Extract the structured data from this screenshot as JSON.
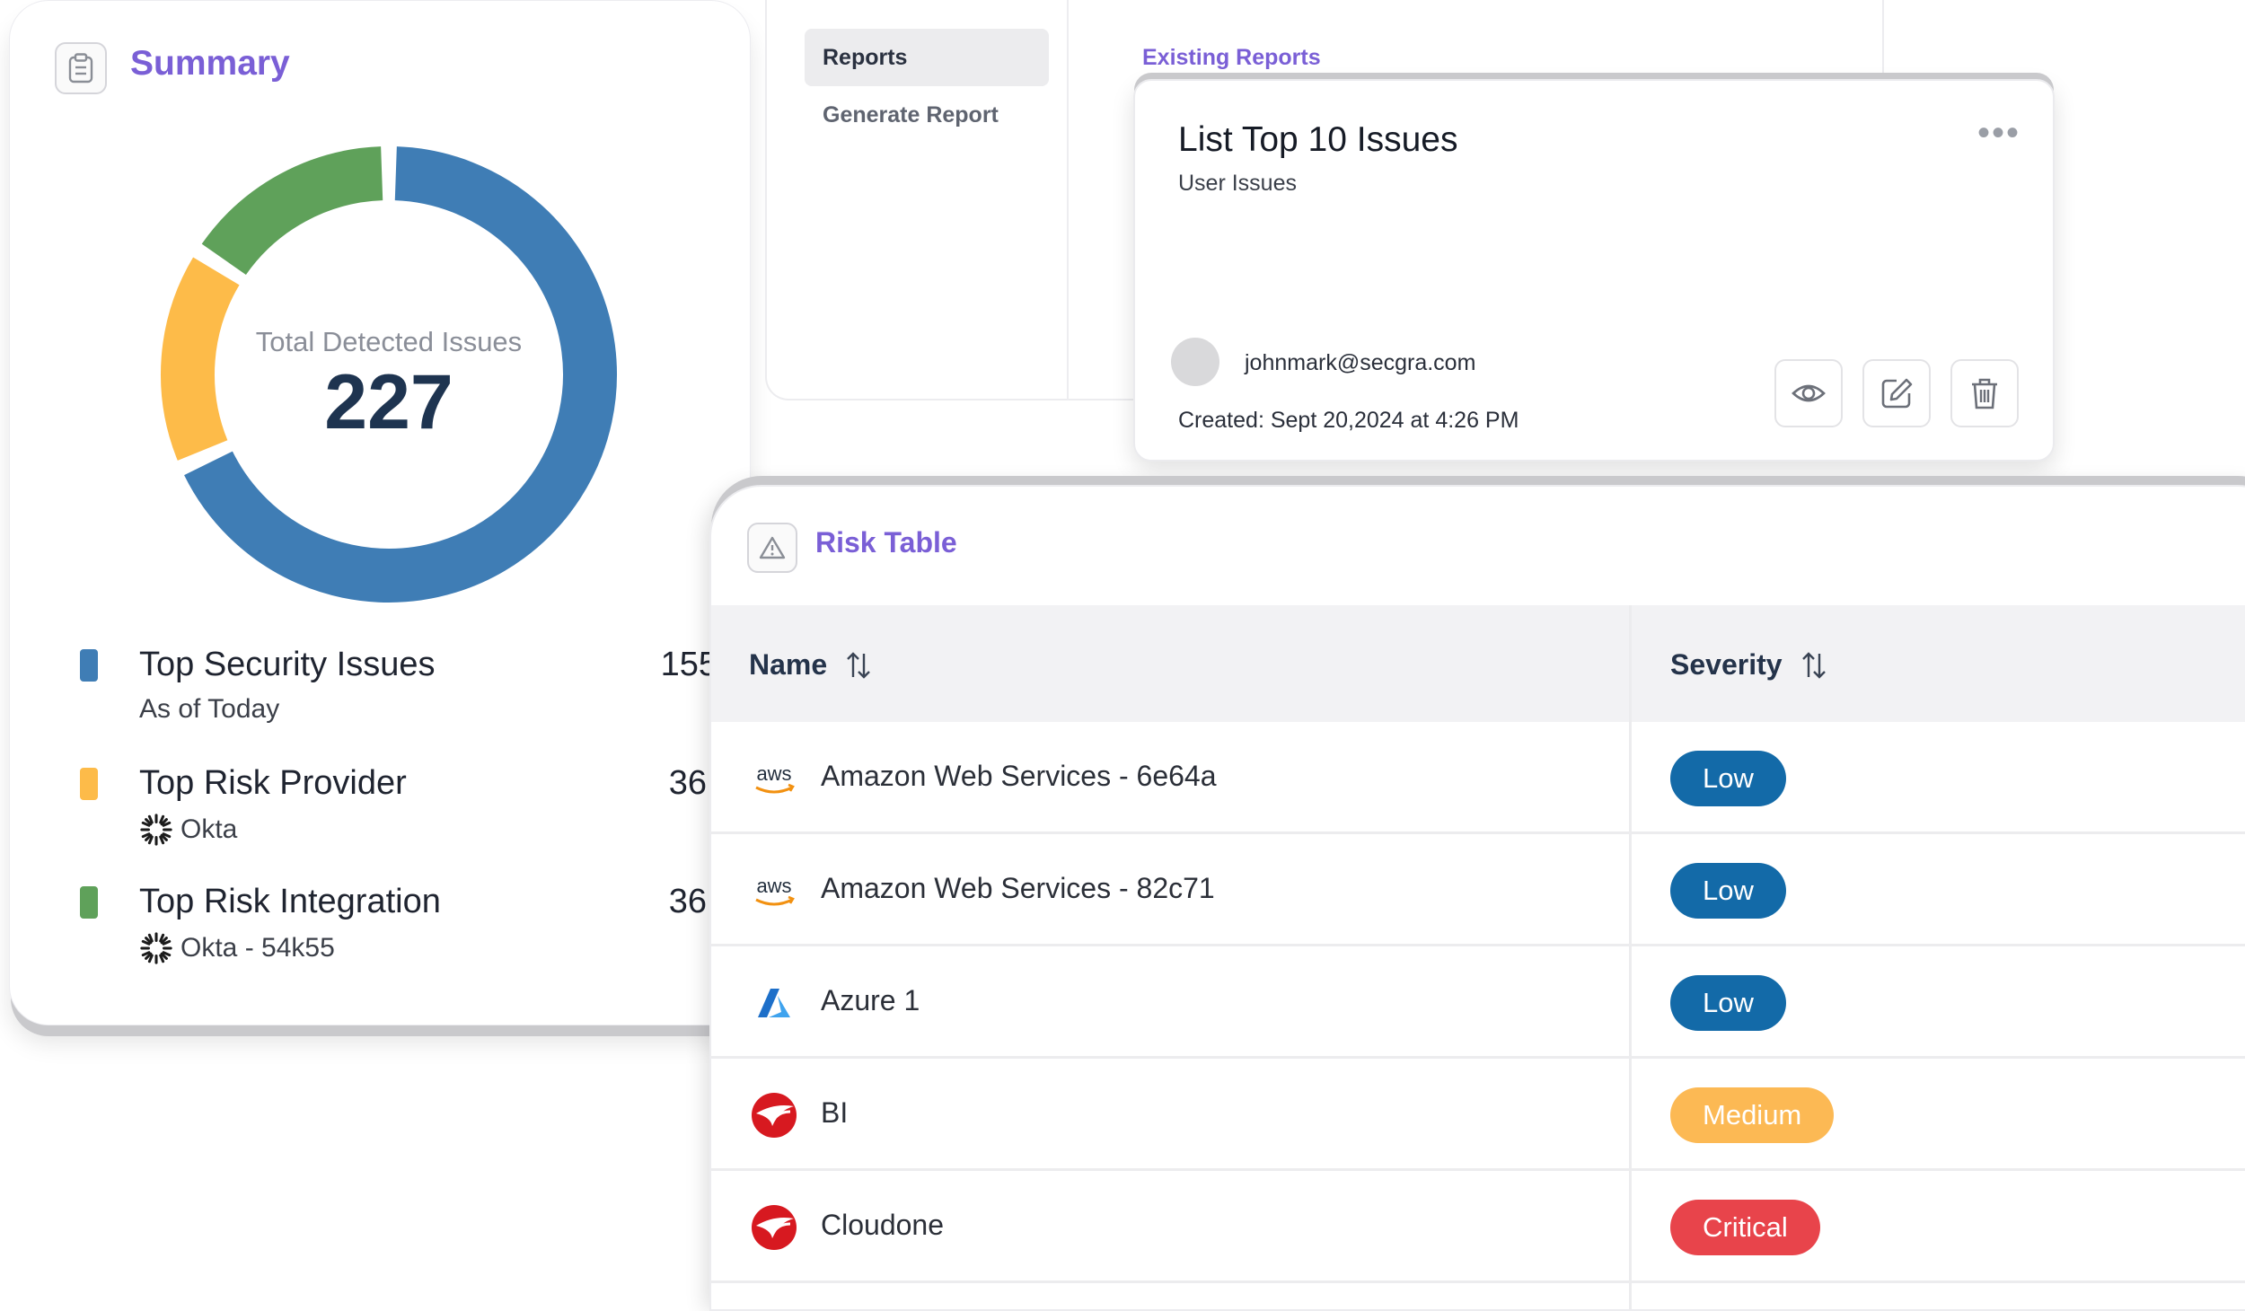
{
  "summary": {
    "title": "Summary",
    "donut_label": "Total Detected Issues",
    "total": "227",
    "segments": [
      {
        "name": "Top Security Issues",
        "value": 155,
        "color": "#3f7db5"
      },
      {
        "name": "Top Risk Provider",
        "value": 36,
        "color": "#fdbb49"
      },
      {
        "name": "Top Risk Integration",
        "value": 36,
        "color": "#5fa15a"
      }
    ],
    "legend": [
      {
        "label": "Top Security Issues",
        "count": "155",
        "sub": "As of Today",
        "color": "#3f7db5"
      },
      {
        "label": "Top Risk Provider",
        "count": "36",
        "sub": "Okta",
        "color": "#fdbb49",
        "icon": "okta-icon"
      },
      {
        "label": "Top Risk Integration",
        "count": "36",
        "sub": "Okta - 54k55",
        "color": "#5fa15a",
        "icon": "okta-icon"
      }
    ]
  },
  "reports": {
    "sidebar": [
      "Reports",
      "Generate Report"
    ],
    "section_title": "Existing Reports",
    "card": {
      "title": "List Top 10 Issues",
      "subtitle": "User Issues",
      "more": "•••",
      "email": "johnmark@secgra.com",
      "created": "Created: Sept 20,2024 at 4:26 PM",
      "actions": [
        "eye-icon",
        "edit-icon",
        "trash-icon"
      ]
    }
  },
  "risk_table": {
    "title": "Risk Table",
    "columns": [
      "Name",
      "Severity"
    ],
    "rows": [
      {
        "name": "Amazon Web Services - 6e64a",
        "logo": "aws-logo",
        "severity": "Low",
        "color": "#136aa8"
      },
      {
        "name": "Amazon Web Services - 82c71",
        "logo": "aws-logo",
        "severity": "Low",
        "color": "#136aa8"
      },
      {
        "name": "Azure 1",
        "logo": "azure-logo",
        "severity": "Low",
        "color": "#136aa8"
      },
      {
        "name": "BI",
        "logo": "trendmicro-logo",
        "severity": "Medium",
        "color": "#fcb954"
      },
      {
        "name": "Cloudone",
        "logo": "trendmicro-logo",
        "severity": "Critical",
        "color": "#e8444b"
      }
    ]
  },
  "colors": {
    "accent": "#7a5fd6",
    "heading": "#1e3450"
  }
}
